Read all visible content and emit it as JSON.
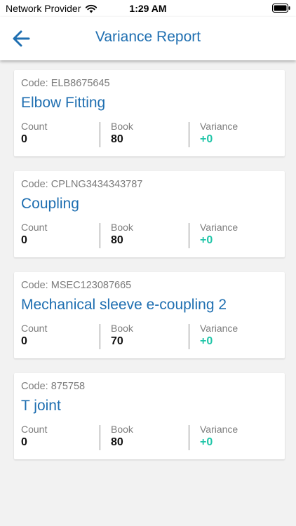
{
  "status_bar": {
    "carrier": "Network Provider",
    "time": "1:29 AM"
  },
  "header": {
    "title": "Variance Report",
    "back_icon": "arrow-left-icon"
  },
  "labels": {
    "code_prefix": "Code:",
    "count": "Count",
    "book": "Book",
    "variance": "Variance"
  },
  "colors": {
    "accent": "#1f6fb1",
    "variance": "#20c5a8"
  },
  "items": [
    {
      "code": "ELB8675645",
      "name": "Elbow Fitting",
      "count": "0",
      "book": "80",
      "variance": "+0"
    },
    {
      "code": "CPLNG3434343787",
      "name": "Coupling",
      "count": "0",
      "book": "80",
      "variance": "+0"
    },
    {
      "code": "MSEC123087665",
      "name": "Mechanical sleeve e-coupling 2",
      "count": "0",
      "book": "70",
      "variance": "+0"
    },
    {
      "code": "875758",
      "name": "T joint",
      "count": "0",
      "book": "80",
      "variance": "+0"
    }
  ]
}
